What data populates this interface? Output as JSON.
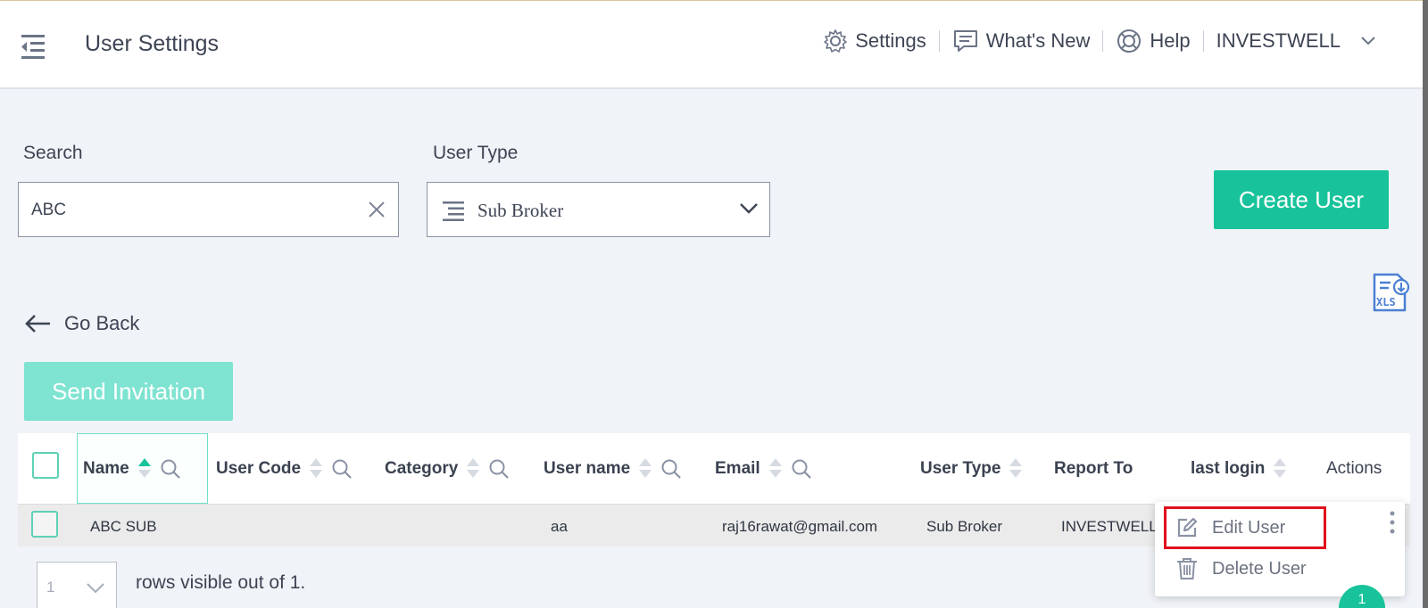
{
  "header": {
    "title": "User Settings",
    "settings_label": "Settings",
    "whats_new_label": "What's New",
    "help_label": "Help",
    "account_label": "INVESTWELL"
  },
  "filters": {
    "search_label": "Search",
    "search_value": "ABC",
    "user_type_label": "User Type",
    "user_type_value": "Sub Broker"
  },
  "actions": {
    "create_user_label": "Create User",
    "go_back_label": "Go Back",
    "send_invitation_label": "Send Invitation",
    "export_icon_text": "XLS"
  },
  "table": {
    "columns": [
      "Name",
      "User Code",
      "Category",
      "User name",
      "Email",
      "User Type",
      "Report To",
      "last login",
      "Actions"
    ],
    "rows": [
      {
        "name": "ABC SUB",
        "user_code": "",
        "category": "",
        "user_name": "aa",
        "email": "raj16rawat@gmail.com",
        "user_type": "Sub Broker",
        "report_to": "INVESTWELL",
        "last_login": ""
      }
    ]
  },
  "row_menu": {
    "edit_label": "Edit User",
    "delete_label": "Delete User"
  },
  "pagination": {
    "rows_per_page": "1",
    "rows_text": "rows visible out of 1.",
    "current_page": "1"
  },
  "colors": {
    "accent": "#18c39b",
    "accent_light": "#7fe3d1",
    "highlight": "#e0101e"
  }
}
